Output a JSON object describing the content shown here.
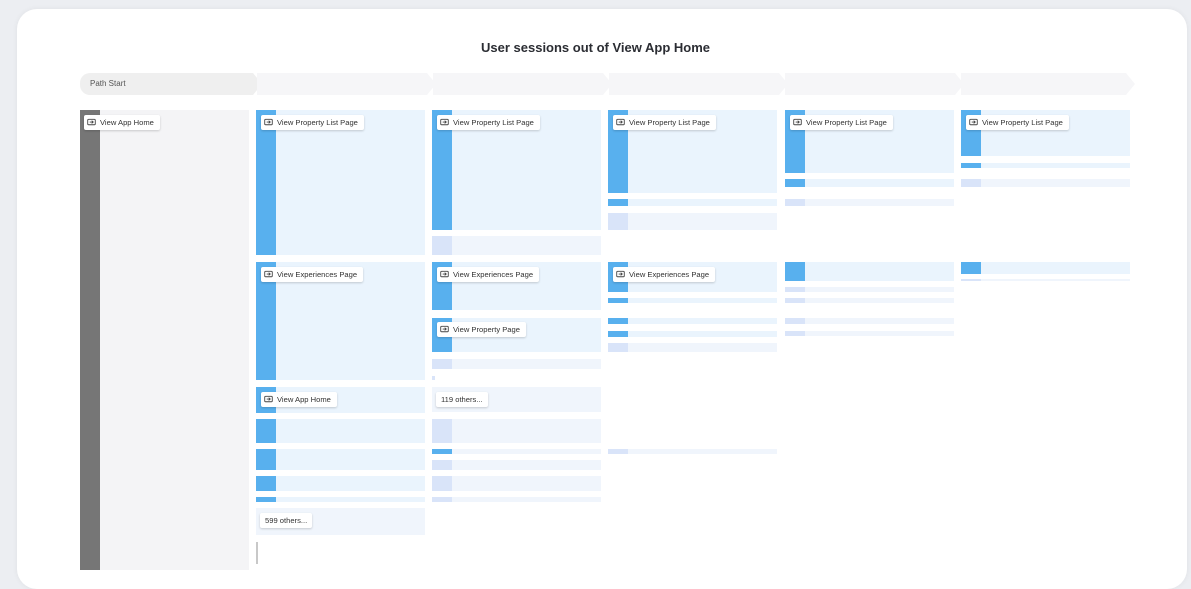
{
  "title": "User sessions out of View App Home",
  "path_header": {
    "start_label": "Path Start"
  },
  "nodes": {
    "root": "View App Home",
    "c1_list": "View Property List Page",
    "c1_exp": "View Experiences Page",
    "c1_home": "View App Home",
    "c1_others": "599 others...",
    "c2_list": "View Property List Page",
    "c2_exp": "View Experiences Page",
    "c2_prop": "View Property Page",
    "c2_others": "119 others...",
    "c3_list": "View Property List Page",
    "c3_exp": "View Experiences Page",
    "c4_list": "View Property List Page",
    "c5_list": "View Property List Page"
  },
  "colors": {
    "node_bar": "#58b0ee",
    "node_fill": "#eaf4fd",
    "pale_bar": "#d9e4f9",
    "root_bar": "#767676"
  },
  "icons": {
    "node_event": "event-icon"
  }
}
